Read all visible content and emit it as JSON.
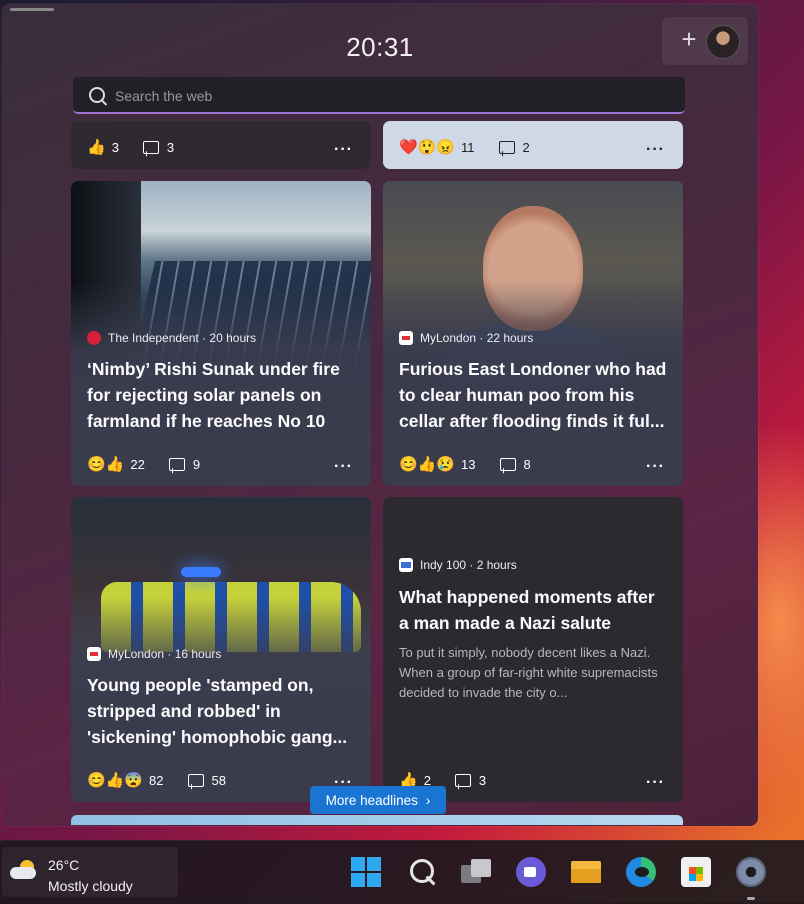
{
  "clock": "20:31",
  "search": {
    "placeholder": "Search the web"
  },
  "stubs": {
    "left": {
      "reactions": "👍",
      "reaction_count": "3",
      "comment_count": "3"
    },
    "right": {
      "reactions": "❤️😲😠",
      "reaction_count": "11",
      "comment_count": "2"
    }
  },
  "cards": [
    {
      "source": "The Independent · 20 hours",
      "headline": "‘Nimby’ Rishi Sunak under fire for rejecting solar panels on farmland if he reaches No 10",
      "reactions": "😊👍",
      "reaction_count": "22",
      "comment_count": "9"
    },
    {
      "source": "MyLondon · 22 hours",
      "headline": "Furious East Londoner who had to clear human poo from his cellar after flooding finds it ful...",
      "reactions": "😊👍😢",
      "reaction_count": "13",
      "comment_count": "8"
    },
    {
      "source": "MyLondon · 16 hours",
      "headline": "Young people 'stamped on, stripped and robbed' in 'sickening' homophobic gang...",
      "reactions": "😊👍😨",
      "reaction_count": "82",
      "comment_count": "58"
    },
    {
      "source": "Indy 100 · 2 hours",
      "headline": "What happened moments after a man made a Nazi salute",
      "summary": "To put it simply, nobody decent likes a Nazi. When a group of far-right white supremacists decided to invade the city o...",
      "reactions": "👍",
      "reaction_count": "2",
      "comment_count": "3"
    }
  ],
  "more_headlines": "More headlines",
  "more_chevron": "›",
  "more_label": "More headlines",
  "dots": "···",
  "taskbar": {
    "weather": {
      "temp": "26°C",
      "condition": "Mostly cloudy"
    },
    "icons": [
      "windows-start-icon",
      "search-icon",
      "task-view-icon",
      "teams-chat-icon",
      "file-explorer-icon",
      "edge-browser-icon",
      "microsoft-store-icon",
      "settings-icon"
    ]
  }
}
